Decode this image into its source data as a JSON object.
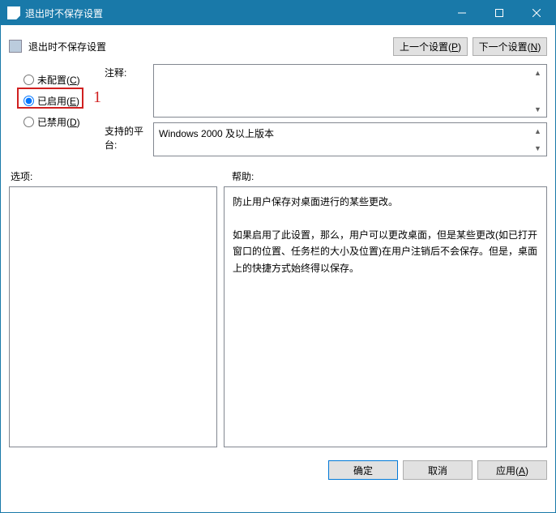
{
  "window": {
    "title": "退出时不保存设置"
  },
  "header": {
    "title": "退出时不保存设置",
    "prev_btn": "上一个设置(P)",
    "next_btn": "下一个设置(N)"
  },
  "radios": {
    "not_configured": "未配置(C)",
    "enabled": "已启用(E)",
    "disabled": "已禁用(D)",
    "selected": "enabled"
  },
  "annotation": {
    "marker": "1"
  },
  "fields": {
    "comment_label": "注释:",
    "comment_value": "",
    "platform_label": "支持的平台:",
    "platform_value": "Windows 2000 及以上版本"
  },
  "sections": {
    "options_label": "选项:",
    "help_label": "帮助:"
  },
  "help_text": {
    "p1": "防止用户保存对桌面进行的某些更改。",
    "p2": "如果启用了此设置，那么，用户可以更改桌面，但是某些更改(如已打开窗口的位置、任务栏的大小及位置)在用户注销后不会保存。但是，桌面上的快捷方式始终得以保存。"
  },
  "buttons": {
    "ok": "确定",
    "cancel": "取消",
    "apply": "应用(A)"
  }
}
